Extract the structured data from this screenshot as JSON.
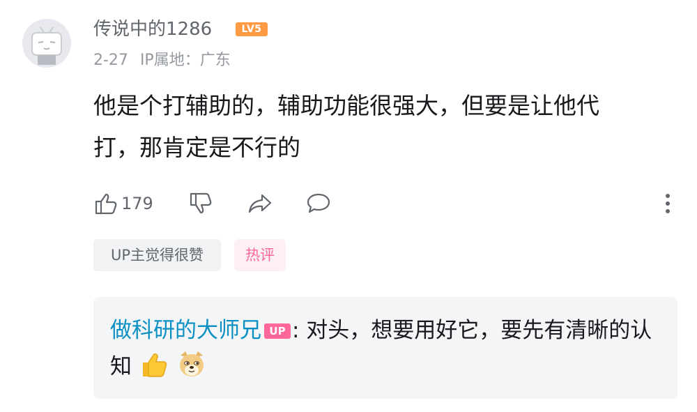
{
  "comment": {
    "username": "传说中的1286",
    "level": "LV5",
    "date": "2-27",
    "ip_location": "IP属地：广东",
    "text": "他是个打辅助的，辅助功能很强大，但要是让他代打，那肯定是不行的",
    "like_count": "179"
  },
  "tags": {
    "up_liked": "UP主觉得很赞",
    "hot": "热评"
  },
  "reply": {
    "author": "做科研的大师兄",
    "badge": "UP",
    "text": ":  对头，想要用好它，要先有清晰的认知",
    "emojis": [
      "thumbs-up-emoji",
      "doge-emoji"
    ]
  },
  "colors": {
    "level_badge": "#ff9a44",
    "up_badge": "#ff6699",
    "reply_author": "#0a8fc3",
    "hot_tag_text": "#ff6699",
    "hot_tag_bg": "#fdf0f3"
  }
}
